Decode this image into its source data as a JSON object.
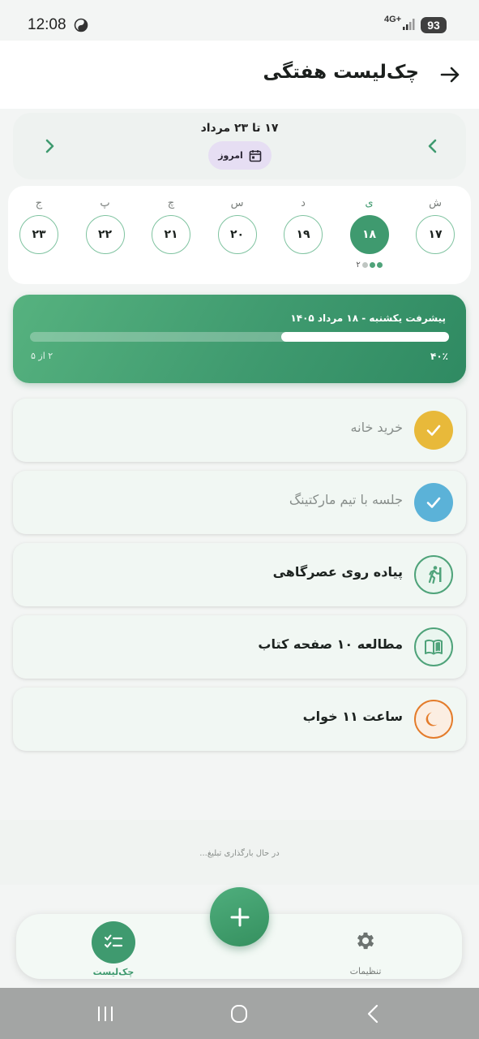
{
  "status_bar": {
    "time": "12:08",
    "network": "4G+",
    "battery": "93"
  },
  "header": {
    "title": "چک‌لیست هفتگی"
  },
  "week": {
    "range": "۱۷ تا ۲۳ مرداد",
    "today_label": "امروز",
    "days": [
      {
        "letter": "ش",
        "number": "۱۷",
        "selected": false
      },
      {
        "letter": "ی",
        "number": "۱۸",
        "selected": true,
        "badge": "۲",
        "dots": [
          "done",
          "done",
          "pending"
        ]
      },
      {
        "letter": "د",
        "number": "۱۹",
        "selected": false
      },
      {
        "letter": "س",
        "number": "۲۰",
        "selected": false
      },
      {
        "letter": "چ",
        "number": "۲۱",
        "selected": false
      },
      {
        "letter": "پ",
        "number": "۲۲",
        "selected": false
      },
      {
        "letter": "ج",
        "number": "۲۳",
        "selected": false
      }
    ]
  },
  "progress": {
    "title": "پیشرفت یکشنبه - ۱۸ مرداد ۱۴۰۵",
    "percent_label": "۴۰٪",
    "fraction": 0.4,
    "count_label": "۲ از ۵"
  },
  "tasks": [
    {
      "label": "خرید خانه",
      "done": true,
      "icon": "check-icon",
      "color": "#e8b93a"
    },
    {
      "label": "جلسه با تیم مارکتینگ",
      "done": true,
      "icon": "check-icon",
      "color": "#5bb2d8"
    },
    {
      "label": "پیاده روی عصرگاهی",
      "done": false,
      "icon": "walking-icon",
      "color": "#4fa37a"
    },
    {
      "label": "مطالعه ۱۰ صفحه کتاب",
      "done": false,
      "icon": "book-icon",
      "color": "#4fa37a"
    },
    {
      "label": "ساعت ۱۱ خواب",
      "done": false,
      "icon": "moon-icon",
      "color": "#e47c2b"
    }
  ],
  "ad": {
    "loading_text": "در حال بارگذاری تبلیغ..."
  },
  "bottom_nav": {
    "checklist_label": "چک‌لیست",
    "settings_label": "تنظیمات"
  },
  "colors": {
    "primary": "#3f9a6f",
    "today_chip": "#e6def3"
  }
}
